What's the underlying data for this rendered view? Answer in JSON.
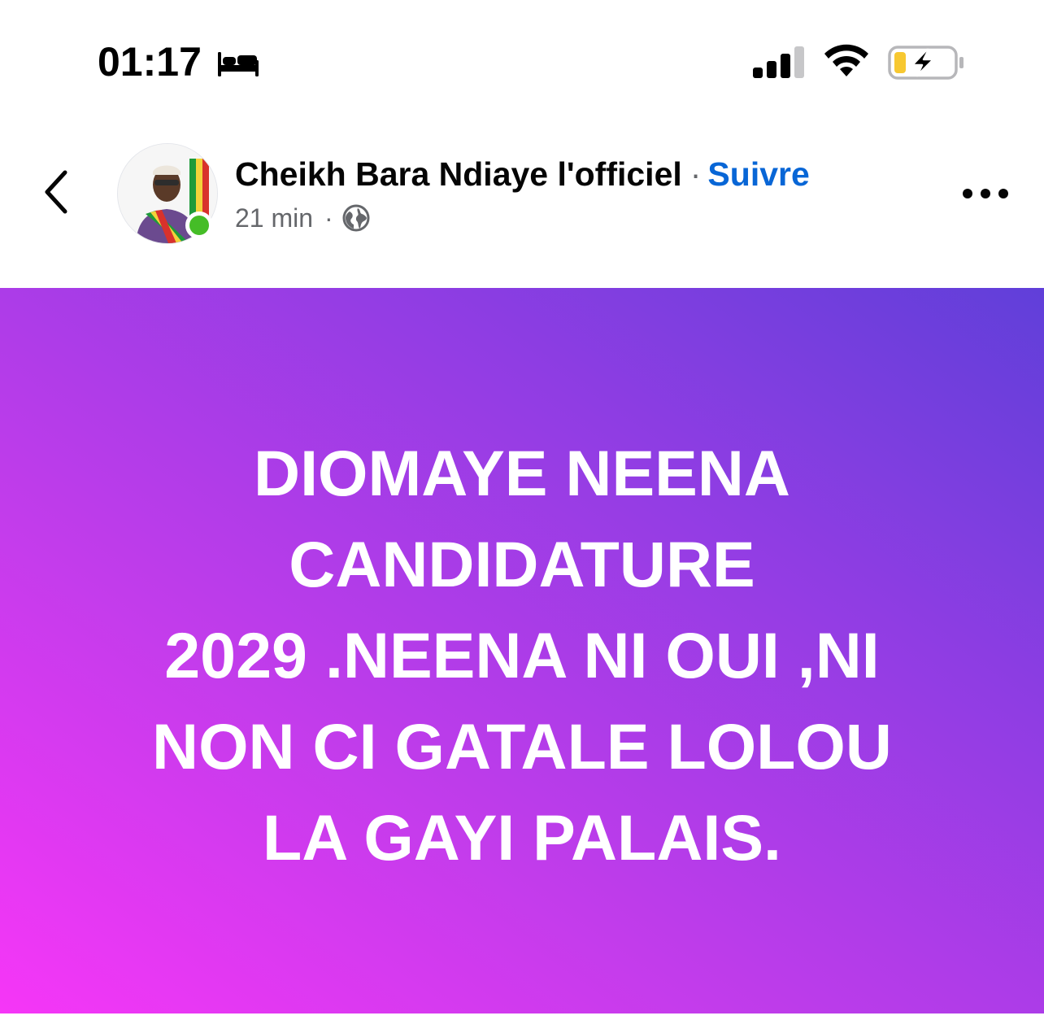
{
  "status_bar": {
    "time": "01:17",
    "focus_icon": "bed-icon",
    "signal_icon": "cellular-signal-icon",
    "wifi_icon": "wifi-icon",
    "battery_icon": "battery-charging-icon",
    "battery_level": 0.25
  },
  "post": {
    "author": "Cheikh Bara Ndiaye l'officiel",
    "separator": "·",
    "follow_label": "Suivre",
    "time_ago": "21 min",
    "meta_separator": "·",
    "audience_icon": "globe-icon",
    "text": "DIOMAYE NEENA\nCANDIDATURE\n2029 .NEENA NI OUI ,NI\nNON CI GATALE LOLOU\nLA GAYI PALAIS."
  },
  "colors": {
    "follow_link": "#0866d6",
    "online_dot": "#45bd27",
    "gradient_start": "#f636f7",
    "gradient_end": "#603fd9",
    "meta_text": "#65676b"
  }
}
